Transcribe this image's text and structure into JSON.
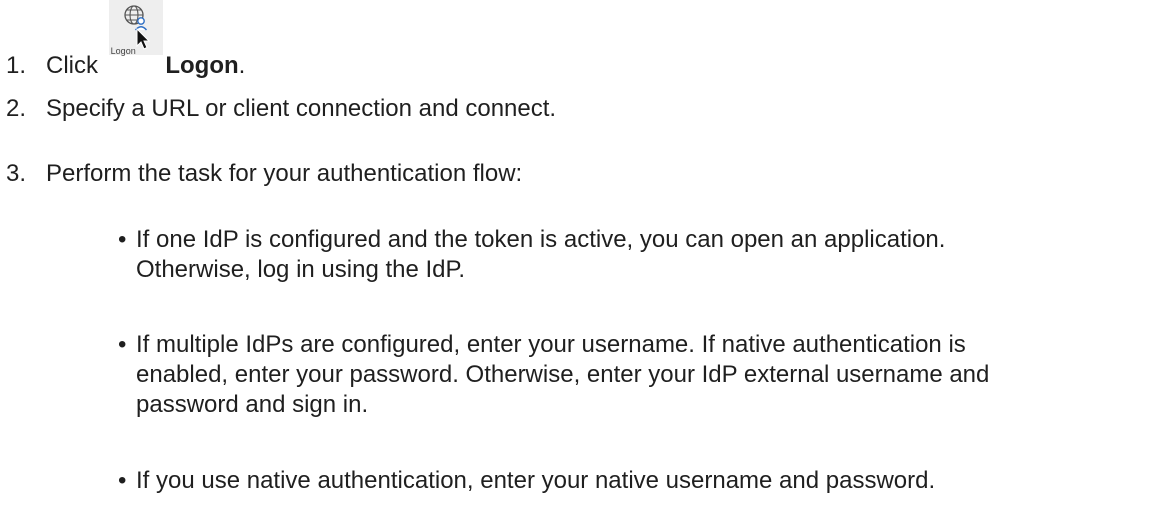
{
  "steps": [
    {
      "number": "1.",
      "text_before": "Click",
      "icon_label": "Logon",
      "icon_name": "globe-user-icon",
      "text_after": "Logon",
      "punct": "."
    },
    {
      "number": "2.",
      "text": "Specify a URL or client connection and connect."
    },
    {
      "number": "3.",
      "text": "Perform the task for your authentication flow:"
    }
  ],
  "bullets": [
    {
      "symbol": "•",
      "lines": [
        "If one IdP is configured and the token is active, you can open an application.",
        "Otherwise, log in using the IdP."
      ]
    },
    {
      "symbol": "•",
      "lines": [
        "If multiple IdPs are configured, enter your username. If native authentication is",
        "enabled, enter your password. Otherwise, enter your IdP external username and",
        "password and sign in."
      ]
    },
    {
      "symbol": "•",
      "lines": [
        "If you use native authentication, enter your native username and password."
      ]
    }
  ],
  "colors": {
    "text": "#1f1f1f",
    "icon_blue": "#2f6fc4",
    "icon_tile": "#eeeeee"
  }
}
